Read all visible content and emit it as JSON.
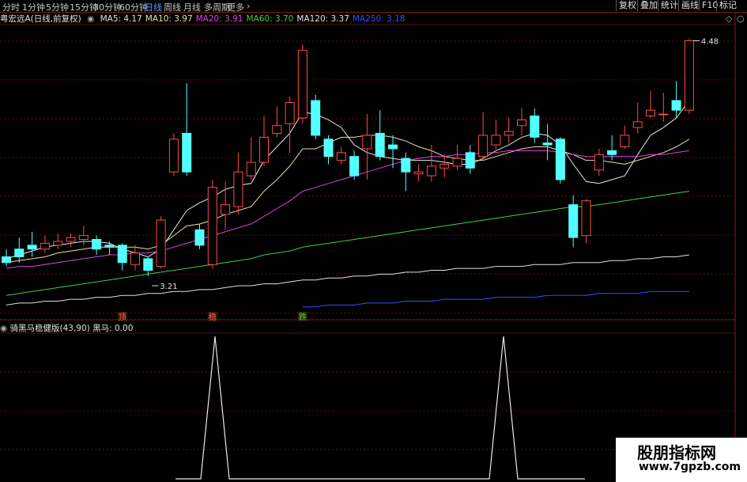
{
  "tabs": [
    "分时",
    "1分钟",
    "5分钟",
    "15分钟",
    "30分钟",
    "60分钟",
    "日线",
    "周线",
    "月线",
    "多周期",
    "更多"
  ],
  "active_tab": "日线",
  "toolbar_right": [
    "复权",
    "叠加",
    "统计",
    "画线",
    "F10",
    "标记"
  ],
  "stock_title": "粤宏远A(日线,前复权)",
  "ma_legend": [
    {
      "label": "MA5: 4.17",
      "color": "#e0e0e0"
    },
    {
      "label": "MA10: 3.97",
      "color": "#e8e0a0"
    },
    {
      "label": "MA20: 3.91",
      "color": "#e040e0"
    },
    {
      "label": "MA60: 3.70",
      "color": "#40d040"
    },
    {
      "label": "MA120: 3.37",
      "color": "#e0e0e0"
    },
    {
      "label": "MA250: 3.18",
      "color": "#3050ff"
    }
  ],
  "indicator_title": "骑黑马稳健版(43,90)",
  "indicator_value": "黑马: 0.00",
  "watermark": {
    "line1": "股朋指标网",
    "line2": "www.7gpzb.com"
  },
  "chart_data": {
    "type": "candlestick",
    "ylim": [
      3.05,
      4.56
    ],
    "annotations": [
      {
        "text": "4.48",
        "candle": 53
      },
      {
        "text": "3.21",
        "candle": 11
      }
    ],
    "markers": [
      {
        "text": "顶",
        "candle": 9,
        "color": "#ff6060"
      },
      {
        "text": "稳",
        "candle": 16,
        "color": "#ff6060"
      },
      {
        "text": "跌",
        "candle": 23,
        "color": "#40e040"
      }
    ],
    "candles": [
      [
        3.36,
        3.33,
        3.4,
        3.31
      ],
      [
        3.4,
        3.36,
        3.46,
        3.33
      ],
      [
        3.42,
        3.4,
        3.49,
        3.36
      ],
      [
        3.4,
        3.43,
        3.47,
        3.38
      ],
      [
        3.42,
        3.44,
        3.48,
        3.4
      ],
      [
        3.44,
        3.46,
        3.48,
        3.41
      ],
      [
        3.45,
        3.47,
        3.52,
        3.42
      ],
      [
        3.45,
        3.4,
        3.47,
        3.37
      ],
      [
        3.42,
        3.41,
        3.44,
        3.37
      ],
      [
        3.42,
        3.33,
        3.43,
        3.29
      ],
      [
        3.32,
        3.38,
        3.42,
        3.29
      ],
      [
        3.35,
        3.29,
        3.36,
        3.26
      ],
      [
        3.31,
        3.55,
        3.57,
        3.3
      ],
      [
        3.8,
        3.97,
        4.0,
        3.78
      ],
      [
        4.0,
        3.8,
        4.26,
        3.78
      ],
      [
        3.5,
        3.42,
        3.53,
        3.4
      ],
      [
        3.32,
        3.72,
        3.76,
        3.3
      ],
      [
        3.58,
        3.63,
        3.75,
        3.5
      ],
      [
        3.62,
        3.8,
        3.9,
        3.58
      ],
      [
        3.78,
        3.85,
        3.98,
        3.76
      ],
      [
        3.85,
        3.98,
        4.09,
        3.83
      ],
      [
        4.0,
        4.04,
        4.14,
        3.98
      ],
      [
        4.05,
        4.16,
        4.19,
        3.9
      ],
      [
        4.08,
        4.43,
        4.46,
        4.05
      ],
      [
        4.17,
        3.99,
        4.2,
        3.97
      ],
      [
        3.97,
        3.88,
        3.99,
        3.84
      ],
      [
        3.86,
        3.9,
        3.93,
        3.84
      ],
      [
        3.88,
        3.78,
        3.91,
        3.76
      ],
      [
        3.92,
        3.99,
        4.1,
        3.76
      ],
      [
        4.0,
        3.88,
        4.12,
        3.86
      ],
      [
        3.94,
        3.92,
        3.99,
        3.82
      ],
      [
        3.87,
        3.8,
        3.9,
        3.7
      ],
      [
        3.79,
        3.8,
        3.84,
        3.75
      ],
      [
        3.78,
        3.83,
        3.94,
        3.75
      ],
      [
        3.82,
        3.84,
        3.89,
        3.77
      ],
      [
        3.83,
        3.87,
        3.94,
        3.81
      ],
      [
        3.9,
        3.82,
        3.94,
        3.79
      ],
      [
        3.88,
        3.99,
        4.11,
        3.86
      ],
      [
        3.94,
        3.99,
        4.07,
        3.92
      ],
      [
        3.99,
        4.01,
        4.08,
        3.95
      ],
      [
        4.04,
        4.07,
        4.13,
        3.99
      ],
      [
        4.09,
        3.98,
        4.13,
        3.95
      ],
      [
        3.95,
        3.94,
        4.05,
        3.86
      ],
      [
        3.97,
        3.76,
        3.98,
        3.74
      ],
      [
        3.63,
        3.46,
        3.68,
        3.41
      ],
      [
        3.47,
        3.65,
        3.66,
        3.43
      ],
      [
        3.81,
        3.89,
        3.92,
        3.78
      ],
      [
        3.91,
        3.89,
        3.99,
        3.86
      ],
      [
        3.93,
        3.99,
        4.04,
        3.92
      ],
      [
        4.03,
        4.06,
        4.16,
        4.0
      ],
      [
        4.09,
        4.12,
        4.22,
        4.08
      ],
      [
        4.1,
        4.1,
        4.21,
        4.06
      ],
      [
        4.17,
        4.12,
        4.27,
        4.08
      ],
      [
        4.12,
        4.48,
        4.49,
        4.1
      ]
    ],
    "ma_series": [
      {
        "name": "MA5",
        "color": "#e8e8e8",
        "values": [
          3.35,
          3.37,
          3.39,
          3.41,
          3.42,
          3.43,
          3.44,
          3.44,
          3.43,
          3.4,
          3.38,
          3.36,
          3.4,
          3.5,
          3.6,
          3.64,
          3.67,
          3.71,
          3.73,
          3.74,
          3.86,
          3.93,
          4.0,
          4.11,
          4.1,
          4.07,
          4.03,
          3.94,
          3.9,
          3.88,
          3.87,
          3.86,
          3.86,
          3.86,
          3.85,
          3.84,
          3.84,
          3.87,
          3.91,
          3.94,
          3.98,
          4.0,
          3.99,
          3.94,
          3.84,
          3.75,
          3.74,
          3.76,
          3.78,
          3.89,
          3.99,
          4.03,
          4.08,
          4.17
        ]
      },
      {
        "name": "MA10",
        "color": "#e8e0a0",
        "values": [
          3.33,
          3.34,
          3.35,
          3.36,
          3.38,
          3.39,
          3.4,
          3.41,
          3.41,
          3.41,
          3.41,
          3.4,
          3.42,
          3.47,
          3.52,
          3.53,
          3.55,
          3.58,
          3.6,
          3.62,
          3.7,
          3.76,
          3.83,
          3.92,
          3.92,
          3.95,
          3.98,
          3.98,
          3.99,
          3.99,
          3.98,
          3.96,
          3.93,
          3.91,
          3.88,
          3.87,
          3.86,
          3.86,
          3.88,
          3.9,
          3.92,
          3.93,
          3.93,
          3.91,
          3.89,
          3.86,
          3.86,
          3.85,
          3.84,
          3.86,
          3.88,
          3.9,
          3.93,
          3.97
        ]
      },
      {
        "name": "MA20",
        "color": "#e040e0",
        "values": [
          3.3,
          3.31,
          3.31,
          3.32,
          3.33,
          3.34,
          3.35,
          3.36,
          3.37,
          3.37,
          3.38,
          3.38,
          3.39,
          3.41,
          3.43,
          3.45,
          3.47,
          3.49,
          3.51,
          3.53,
          3.57,
          3.61,
          3.65,
          3.7,
          3.72,
          3.74,
          3.76,
          3.78,
          3.8,
          3.82,
          3.84,
          3.86,
          3.87,
          3.88,
          3.88,
          3.89,
          3.89,
          3.9,
          3.9,
          3.91,
          3.91,
          3.91,
          3.91,
          3.9,
          3.89,
          3.88,
          3.88,
          3.88,
          3.88,
          3.88,
          3.89,
          3.89,
          3.9,
          3.91
        ]
      },
      {
        "name": "MA60",
        "color": "#40d040",
        "values": [
          3.16,
          3.17,
          3.18,
          3.19,
          3.2,
          3.21,
          3.22,
          3.23,
          3.24,
          3.25,
          3.26,
          3.27,
          3.28,
          3.29,
          3.3,
          3.31,
          3.32,
          3.33,
          3.34,
          3.35,
          3.37,
          3.38,
          3.39,
          3.41,
          3.42,
          3.43,
          3.44,
          3.45,
          3.46,
          3.47,
          3.48,
          3.49,
          3.5,
          3.51,
          3.52,
          3.53,
          3.54,
          3.55,
          3.56,
          3.57,
          3.58,
          3.59,
          3.6,
          3.61,
          3.62,
          3.62,
          3.63,
          3.64,
          3.65,
          3.66,
          3.67,
          3.68,
          3.69,
          3.7
        ]
      },
      {
        "name": "MA120",
        "color": "#e0e0e0",
        "values": [
          3.11,
          3.12,
          3.12,
          3.13,
          3.13,
          3.14,
          3.14,
          3.15,
          3.15,
          3.16,
          3.16,
          3.17,
          3.17,
          3.18,
          3.18,
          3.19,
          3.19,
          3.2,
          3.21,
          3.21,
          3.22,
          3.22,
          3.23,
          3.24,
          3.24,
          3.25,
          3.25,
          3.26,
          3.26,
          3.27,
          3.27,
          3.28,
          3.28,
          3.29,
          3.29,
          3.3,
          3.3,
          3.3,
          3.31,
          3.31,
          3.31,
          3.32,
          3.32,
          3.32,
          3.33,
          3.33,
          3.33,
          3.34,
          3.34,
          3.35,
          3.35,
          3.36,
          3.36,
          3.37
        ]
      },
      {
        "name": "MA250",
        "color": "#3050ff",
        "start": 23,
        "values": [
          3.1,
          3.1,
          3.11,
          3.11,
          3.11,
          3.12,
          3.12,
          3.12,
          3.13,
          3.13,
          3.13,
          3.14,
          3.14,
          3.14,
          3.14,
          3.15,
          3.15,
          3.15,
          3.15,
          3.16,
          3.16,
          3.16,
          3.16,
          3.17,
          3.17,
          3.17,
          3.17,
          3.18,
          3.18,
          3.18,
          3.18
        ]
      }
    ],
    "indicator": {
      "name": "黑马",
      "spikes": [
        16,
        39
      ],
      "max": 1
    }
  }
}
